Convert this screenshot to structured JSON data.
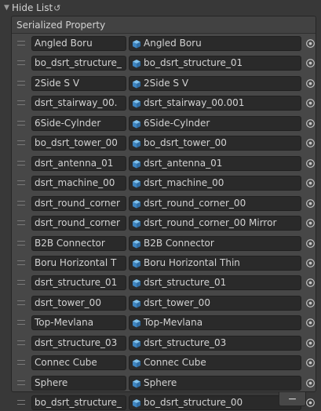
{
  "foldout": {
    "title": "Hide List",
    "reset_glyph": "↺",
    "icon": "triangle-down-icon"
  },
  "panel": {
    "header": "Serialized Property"
  },
  "icons": {
    "object": "cube-icon",
    "picker": "circle-dot-icon"
  },
  "rows": [
    {
      "name": "Angled Boru",
      "object": "Angled Boru"
    },
    {
      "name": "bo_dsrt_structure_",
      "object": "bo_dsrt_structure_01"
    },
    {
      "name": "2Side S V",
      "object": "2Side S V"
    },
    {
      "name": "dsrt_stairway_00.",
      "object": "dsrt_stairway_00.001"
    },
    {
      "name": "6Side-Cylnder",
      "object": "6Side-Cylnder"
    },
    {
      "name": "bo_dsrt_tower_00",
      "object": "bo_dsrt_tower_00"
    },
    {
      "name": "dsrt_antenna_01",
      "object": "dsrt_antenna_01"
    },
    {
      "name": "dsrt_machine_00",
      "object": "dsrt_machine_00"
    },
    {
      "name": "dsrt_round_corner",
      "object": "dsrt_round_corner_00"
    },
    {
      "name": "dsrt_round_corner",
      "object": "dsrt_round_corner_00 Mirror"
    },
    {
      "name": "B2B Connector",
      "object": "B2B Connector"
    },
    {
      "name": "Boru Horizontal T",
      "object": "Boru Horizontal Thin"
    },
    {
      "name": "dsrt_structure_01",
      "object": "dsrt_structure_01"
    },
    {
      "name": "dsrt_tower_00",
      "object": "dsrt_tower_00"
    },
    {
      "name": "Top-Mevlana",
      "object": "Top-Mevlana"
    },
    {
      "name": "dsrt_structure_03",
      "object": "dsrt_structure_03"
    },
    {
      "name": "Connec Cube",
      "object": "Connec Cube"
    },
    {
      "name": "Sphere",
      "object": "Sphere"
    },
    {
      "name": "bo_dsrt_structure_",
      "object": "bo_dsrt_structure_00"
    }
  ],
  "footer": {
    "remove_label": "−"
  },
  "colors": {
    "background": "#383838",
    "panel": "#474747",
    "field": "#2a2a2a",
    "cube_icon": "#4a90c8"
  }
}
